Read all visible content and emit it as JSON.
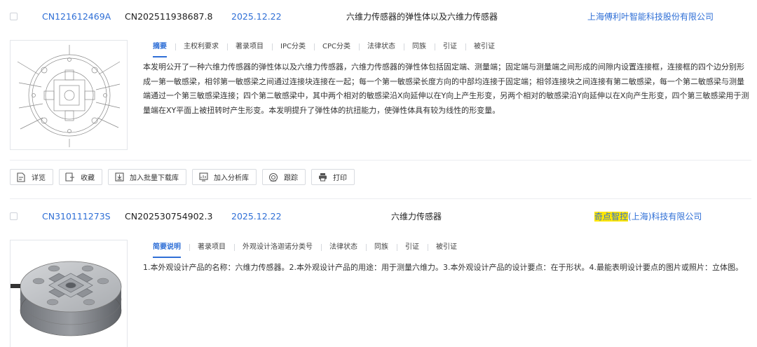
{
  "results": [
    {
      "pub_no": "CN121612469A",
      "app_no": "CN202511938687.8",
      "date": "2025.12.22",
      "title": "六维力传感器的弹性体以及六维力传感器",
      "applicant": "上海傅利叶智能科技股份有限公司",
      "tabs": [
        "摘要",
        "主权利要求",
        "著录项目",
        "IPC分类",
        "CPC分类",
        "法律状态",
        "同族",
        "引证",
        "被引证"
      ],
      "active_tab": 0,
      "abstract": "本发明公开了一种六维力传感器的弹性体以及六维力传感器，六维力传感器的弹性体包括固定端、测量端；固定端与测量端之间形成的间隙内设置连接框，连接框的四个边分别形成一第一敏感梁，相邻第一敏感梁之间通过连接块连接在一起；每一个第一敏感梁长度方向的中部均连接于固定端；相邻连接块之间连接有第二敏感梁，每一个第二敏感梁与测量端通过一个第三敏感梁连接；四个第二敏感梁中，其中两个相对的敏感梁沿X向延伸以在Y向上产生形变，另两个相对的敏感梁沿Y向延伸以在X向产生形变，四个第三敏感梁用于测量端在XY平面上被扭转时产生形变。本发明提升了弹性体的抗扭能力，使弹性体具有较为线性的形变量。"
    },
    {
      "pub_no": "CN310111273S",
      "app_no": "CN202530754902.3",
      "date": "2025.12.22",
      "title": "六维力传感器",
      "applicant_highlight": "奇点智控",
      "applicant_rest": "(上海)科技有限公司",
      "tabs": [
        "简要说明",
        "著录项目",
        "外观设计洛迦诺分类号",
        "法律状态",
        "同族",
        "引证",
        "被引证"
      ],
      "active_tab": 0,
      "abstract": "1.本外观设计产品的名称：六维力传感器。2.本外观设计产品的用途：用于测量六维力。3.本外观设计产品的设计要点：在于形状。4.最能表明设计要点的图片或照片：立体图。"
    }
  ],
  "actions": [
    {
      "label": "详览",
      "icon": "document-icon"
    },
    {
      "label": "收藏",
      "icon": "bookmark-icon"
    },
    {
      "label": "加入批量下载库",
      "icon": "download-box-icon"
    },
    {
      "label": "加入分析库",
      "icon": "analysis-icon"
    },
    {
      "label": "跟踪",
      "icon": "radar-icon"
    },
    {
      "label": "打印",
      "icon": "printer-icon"
    }
  ],
  "colors": {
    "link": "#2f6fd6",
    "highlight": "#ffe600",
    "border": "#d8dbe0"
  }
}
